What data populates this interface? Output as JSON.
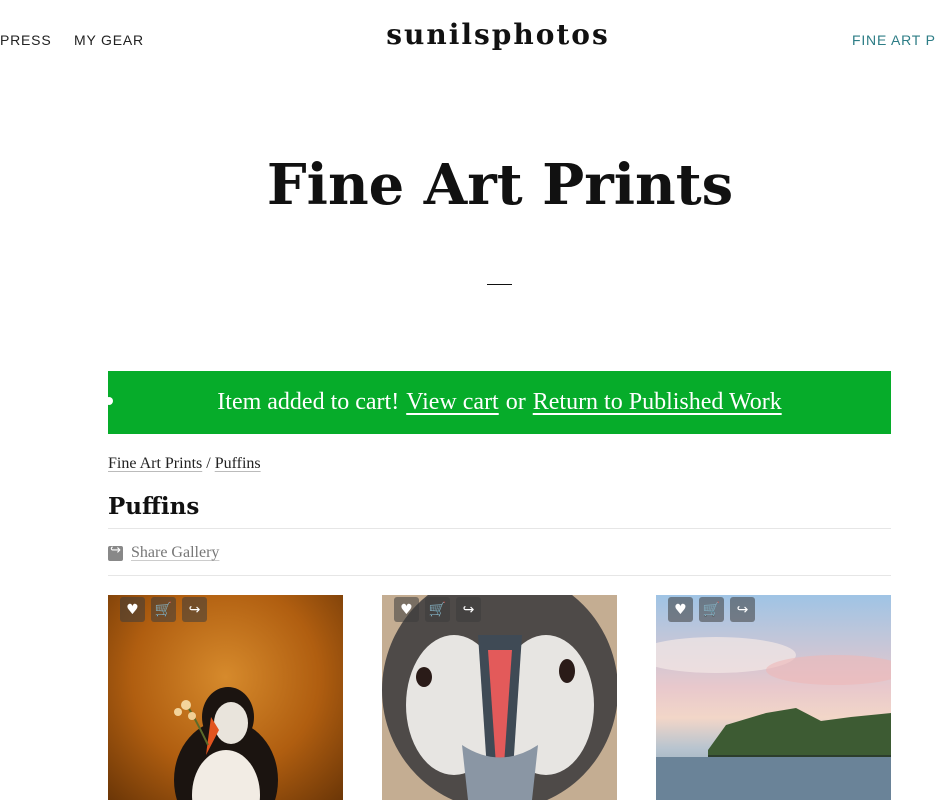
{
  "nav": {
    "left": [
      "PRESS",
      "MY GEAR"
    ],
    "right": "FINE ART PR"
  },
  "site_logo": "sunilsphotos",
  "page_title": "Fine Art Prints",
  "alert": {
    "prefix": "Item added to cart!",
    "view_cart": "View cart",
    "or": "or",
    "return_link": "Return to Published Work",
    "color": "#06ac2a"
  },
  "breadcrumb": {
    "parent": "Fine Art Prints",
    "separator": "/",
    "current": "Puffins"
  },
  "gallery": {
    "title": "Puffins",
    "share_label": "Share Gallery"
  },
  "tile_actions": {
    "favorite_icon": "♥",
    "cart_icon": "🛒",
    "share_icon": "↪"
  },
  "accent_colors": {
    "nav_highlight": "#2d7d86"
  }
}
